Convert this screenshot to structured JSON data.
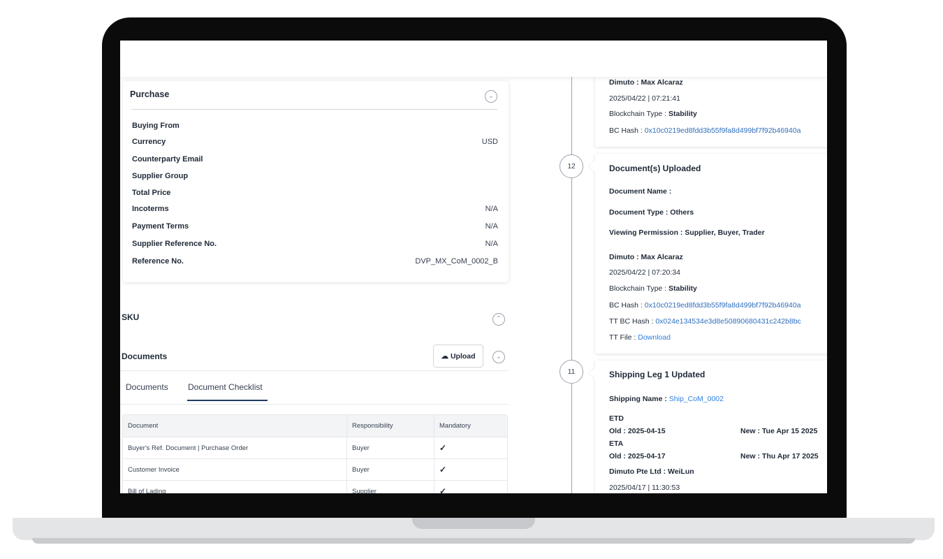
{
  "purchase": {
    "title": "Purchase",
    "fields": [
      {
        "label": "Buying From",
        "value": ""
      },
      {
        "label": "Currency",
        "value": "USD"
      },
      {
        "label": "Counterparty Email",
        "value": ""
      },
      {
        "label": "Supplier Group",
        "value": ""
      },
      {
        "label": "Total Price",
        "value": ""
      },
      {
        "label": "Incoterms",
        "value": "N/A"
      },
      {
        "label": "Payment Terms",
        "value": "N/A"
      },
      {
        "label": "Supplier Reference No.",
        "value": "N/A"
      },
      {
        "label": "Reference No.",
        "value": "DVP_MX_CoM_0002_B"
      }
    ]
  },
  "sku": {
    "title": "SKU"
  },
  "documents": {
    "title": "Documents",
    "upload_label": "Upload",
    "tabs": [
      "Documents",
      "Document Checklist"
    ],
    "active_tab": "Document Checklist",
    "table": {
      "headers": [
        "Document",
        "Responsibility",
        "Mandatory"
      ],
      "rows": [
        {
          "document": "Buyer's Ref. Document | Purchase Order",
          "responsibility": "Buyer",
          "mandatory": true
        },
        {
          "document": "Customer Invoice",
          "responsibility": "Buyer",
          "mandatory": true
        },
        {
          "document": "Bill of Lading",
          "responsibility": "Supplier",
          "mandatory": true
        }
      ]
    }
  },
  "timeline": {
    "top_event": {
      "actor": "Dimuto : Max Alcaraz",
      "timestamp": "2025/04/22 | 07:21:41",
      "blockchain_label": "Blockchain Type : ",
      "blockchain_value": "Stability",
      "bc_hash_label": "BC Hash : ",
      "bc_hash_value": "0x10c0219ed8fdd3b55f9fa8d499bf7f92b46940a"
    },
    "event_12": {
      "step": "12",
      "title": "Document(s) Uploaded",
      "document_name": "Document Name :",
      "document_type": "Document Type : Others",
      "viewing_permission": "Viewing Permission : Supplier, Buyer, Trader",
      "actor": "Dimuto : Max Alcaraz",
      "timestamp": "2025/04/22 | 07:20:34",
      "blockchain_label": "Blockchain Type : ",
      "blockchain_value": "Stability",
      "bc_hash_label": "BC Hash : ",
      "bc_hash_value": "0x10c0219ed8fdd3b55f9fa8d499bf7f92b46940a",
      "tt_bc_hash_label": "TT BC Hash : ",
      "tt_bc_hash_value": "0x024e134534e3d8e50890680431c242b8bc",
      "tt_file_label": "TT File : ",
      "tt_file_link": "Download"
    },
    "event_11": {
      "step": "11",
      "title": "Shipping Leg 1 Updated",
      "shipping_name_label": "Shipping Name : ",
      "shipping_name_value": "Ship_CoM_0002",
      "etd_label": "ETD",
      "etd_old": "Old : 2025-04-15",
      "etd_new": "New : Tue Apr 15 2025",
      "eta_label": "ETA",
      "eta_old": "Old : 2025-04-17",
      "eta_new": "New : Thu Apr 17 2025",
      "actor": "Dimuto Pte Ltd : WeiLun",
      "timestamp": "2025/04/17 | 11:30:53"
    }
  },
  "icons": {
    "chevron_down": "chevron-down-icon",
    "chevron_up": "chevron-up-icon",
    "upload": "cloud-upload-icon",
    "check": "checkbox-checked-icon"
  }
}
